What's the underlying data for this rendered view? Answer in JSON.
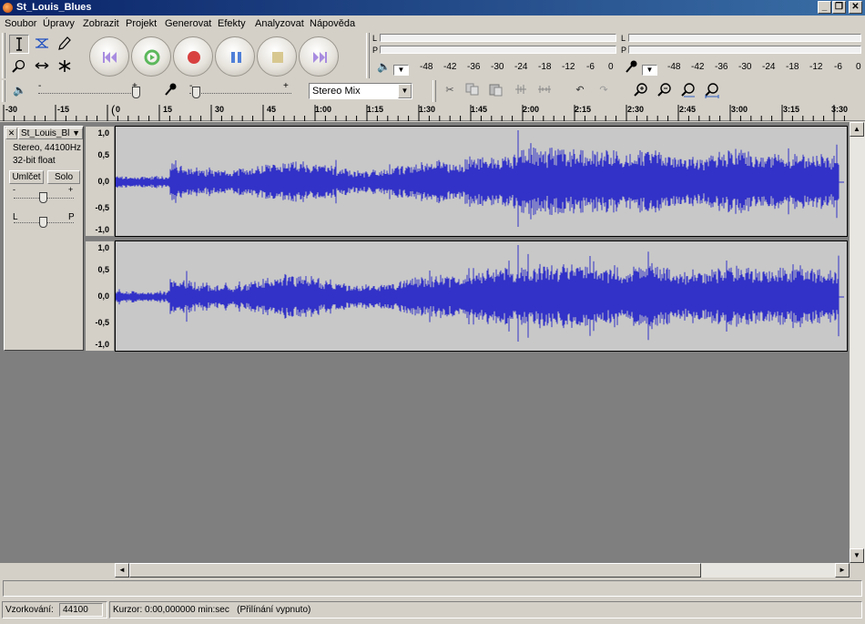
{
  "window": {
    "title": "St_Louis_Blues",
    "minimize_glyph": "_",
    "maximize_glyph": "❐",
    "close_glyph": "✕"
  },
  "menu": [
    "Soubor",
    "Úpravy",
    "Zobrazit",
    "Projekt",
    "Generovat",
    "Efekty",
    "Analyzovat",
    "Nápověda"
  ],
  "tools": {
    "selection": "selection-tool-icon",
    "envelope": "envelope-tool-icon",
    "draw": "draw-tool-icon",
    "zoom": "zoom-tool-icon",
    "timeshift": "timeshift-tool-icon",
    "multi": "multi-tool-icon"
  },
  "transport": [
    "skip-start-icon",
    "play-icon",
    "record-icon",
    "pause-icon",
    "stop-icon",
    "skip-end-icon"
  ],
  "meters": {
    "left_label": "L",
    "right_label": "P",
    "ticks": [
      "-48",
      "-42",
      "-36",
      "-30",
      "-24",
      "-18",
      "-12",
      "-6",
      "0"
    ]
  },
  "mixer": {
    "input_source": "Stereo Mix",
    "slider_min": "-",
    "slider_max": "+"
  },
  "ruler": {
    "labels": [
      "-30",
      "-15",
      "0",
      "15",
      "30",
      "45",
      "1:00",
      "1:15",
      "1:30",
      "1:45",
      "2:00",
      "2:15",
      "2:30",
      "2:45",
      "3:00",
      "3:15",
      "3:30"
    ]
  },
  "track": {
    "name": "St_Louis_Bl",
    "info_line1": "Stereo, 44100Hz",
    "info_line2": "32-bit float",
    "mute_label": "Umlčet",
    "solo_label": "Solo",
    "gain_min": "-",
    "gain_max": "+",
    "pan_left": "L",
    "pan_right": "P",
    "scale_labels": [
      "1,0",
      "0,5",
      "0,0",
      "-0,5",
      "-1,0"
    ],
    "close_glyph": "✕"
  },
  "status": {
    "rate_label": "Vzorkování:",
    "rate_value": "44100",
    "cursor_text": "Kurzor: 0:00,000000 min:sec   (Přilínání vypnuto)"
  },
  "colors": {
    "waveform": "#3232c8",
    "title_bar_start": "#0a246a",
    "title_bar_end": "#3a6ea5"
  }
}
